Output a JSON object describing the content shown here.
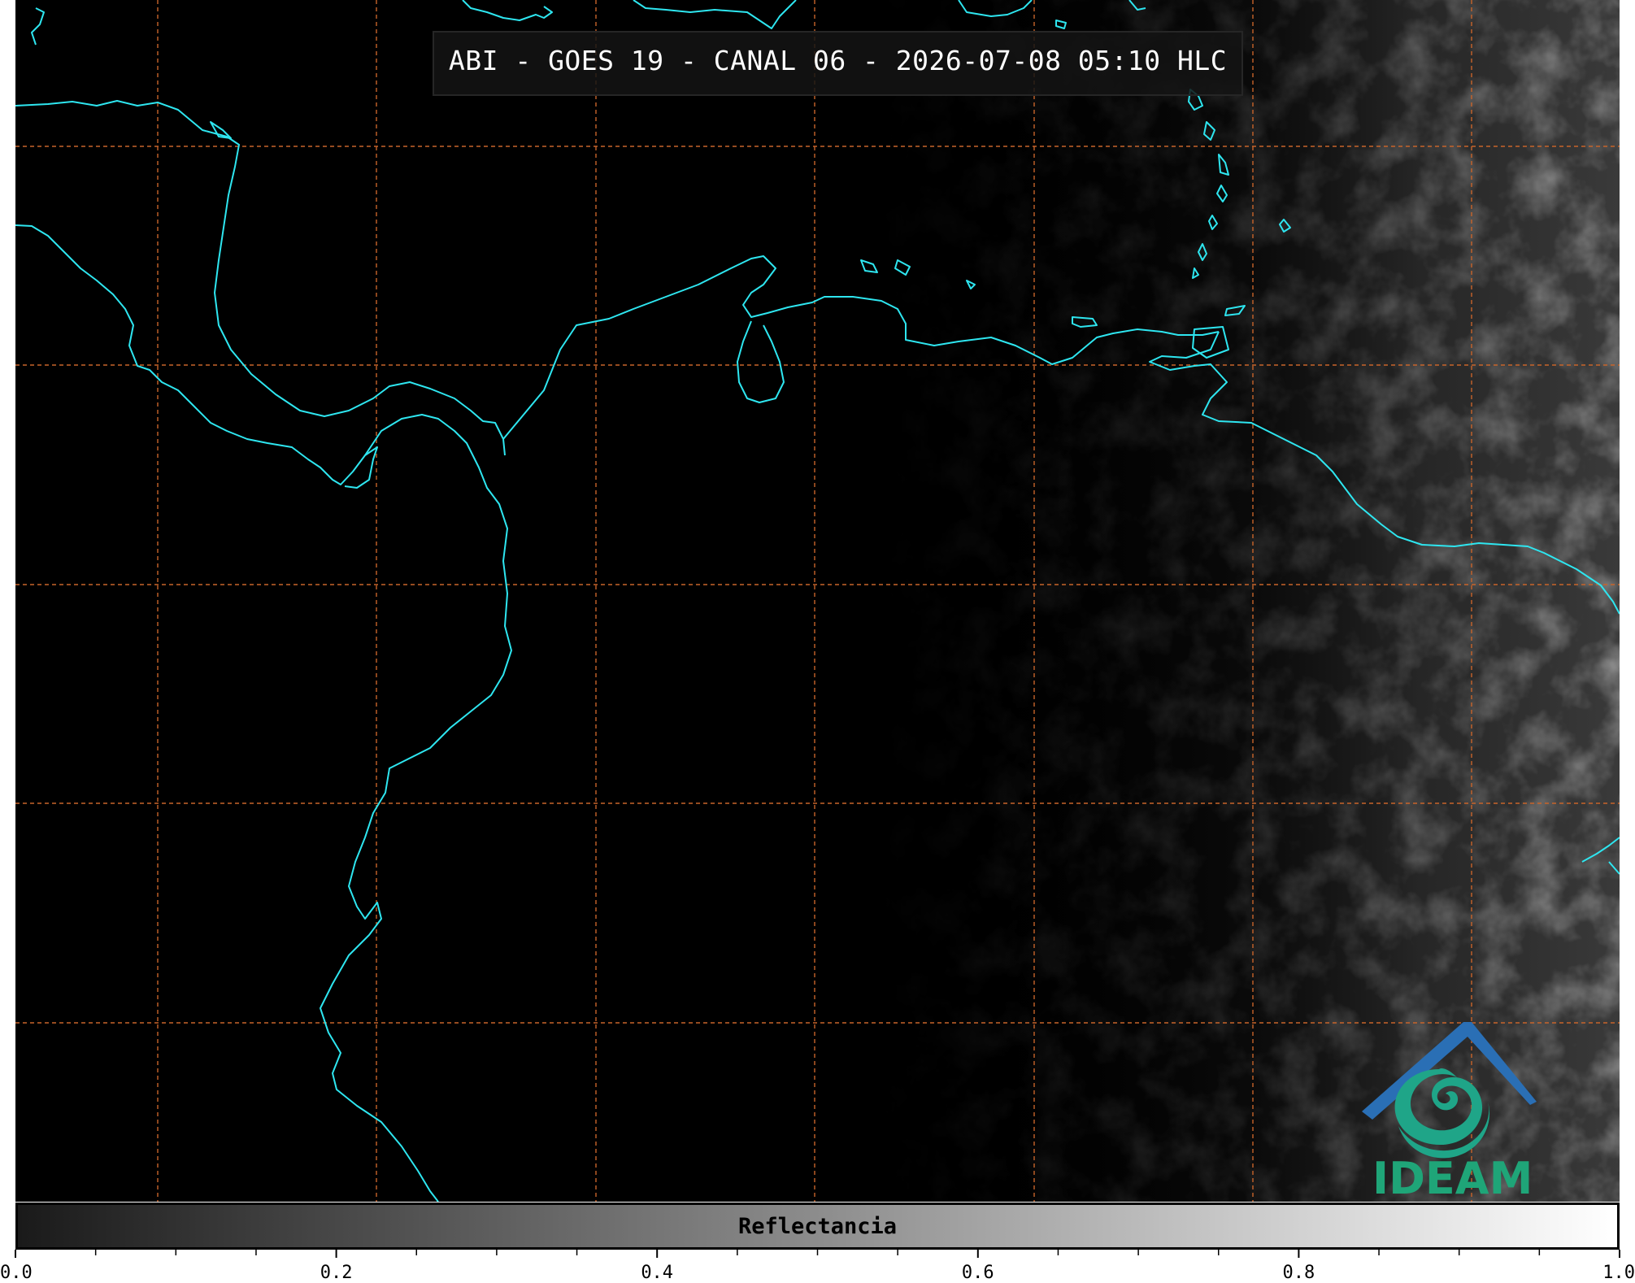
{
  "title": "ABI - GOES 19 - CANAL 06 - 2026-07-08 05:10 HLC",
  "colorbar": {
    "label": "Reflectancia",
    "min": 0.0,
    "max": 1.0,
    "tick_labels": [
      "0.0",
      "0.2",
      "0.4",
      "0.6",
      "0.8",
      "1.0"
    ],
    "colormap": "grayscale",
    "color_low": "#1a1a1a",
    "color_high": "#ffffff"
  },
  "logo": {
    "text": "IDEAM",
    "roof_color": "#2a6fb5",
    "swirl_color": "#1fa588"
  },
  "map": {
    "background": "#000000",
    "coastline_color": "#2ee6f0",
    "grid_color": "#c8642a",
    "grid_style": "dashed",
    "cloud_shading": "gray reflectance over eastern portion"
  }
}
